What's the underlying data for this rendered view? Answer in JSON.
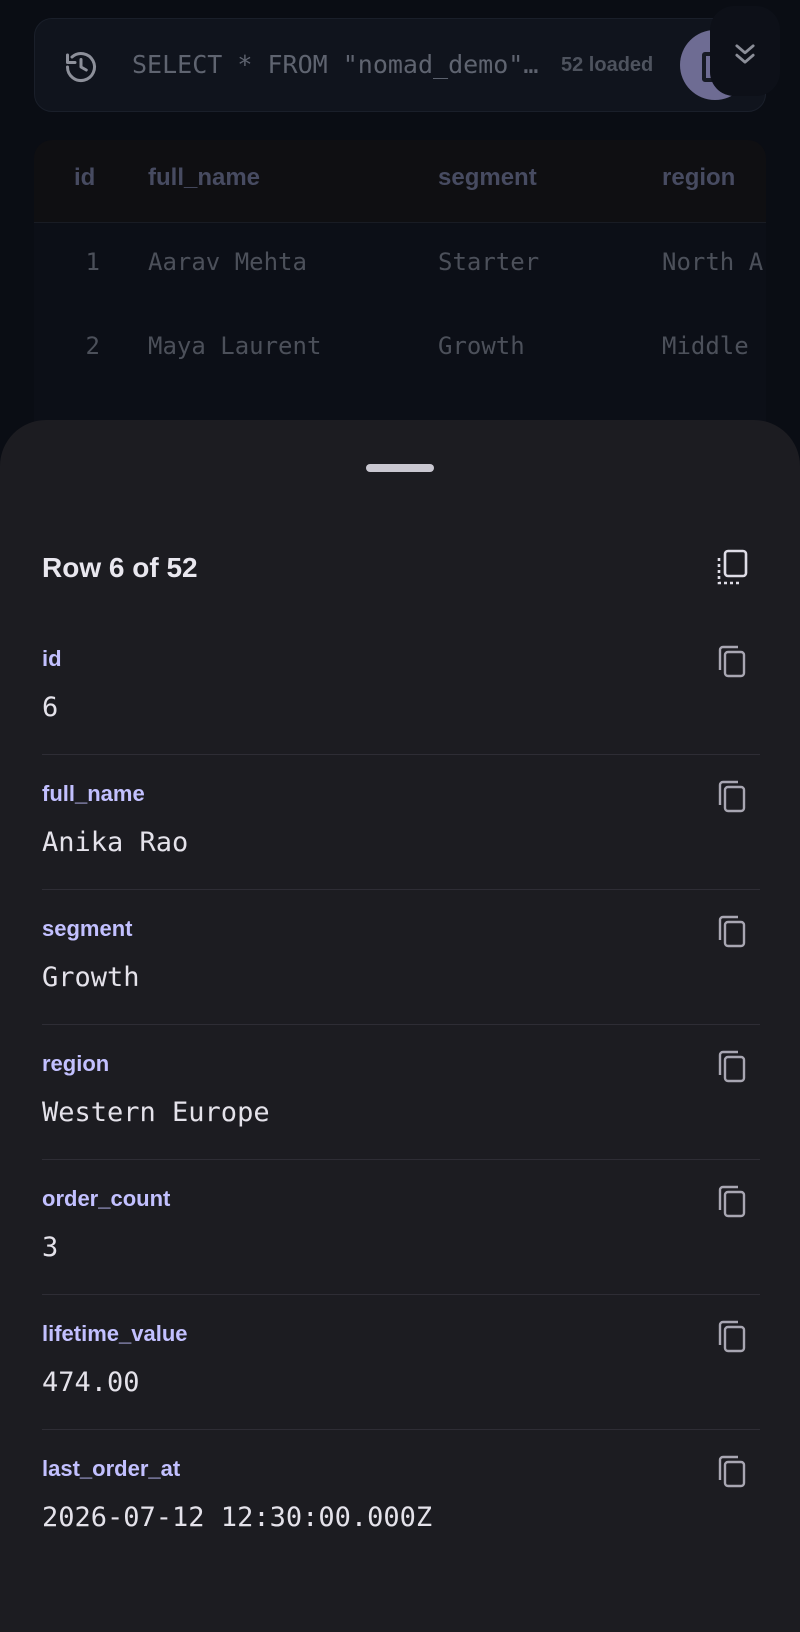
{
  "query_bar": {
    "query_text": "SELECT * FROM \"nomad_demo\"…",
    "loaded_label": "52 loaded"
  },
  "table": {
    "columns": [
      "id",
      "full_name",
      "segment",
      "region"
    ],
    "rows": [
      [
        "1",
        "Aarav Mehta",
        "Starter",
        "North A"
      ],
      [
        "2",
        "Maya Laurent",
        "Growth",
        "Middle"
      ]
    ]
  },
  "sheet": {
    "title": "Row 6 of 52",
    "fields": [
      {
        "label": "id",
        "value": "6"
      },
      {
        "label": "full_name",
        "value": "Anika Rao"
      },
      {
        "label": "segment",
        "value": "Growth"
      },
      {
        "label": "region",
        "value": "Western Europe"
      },
      {
        "label": "order_count",
        "value": "3"
      },
      {
        "label": "lifetime_value",
        "value": "474.00"
      },
      {
        "label": "last_order_at",
        "value": "2026-07-12 12:30:00.000Z"
      }
    ]
  },
  "icons": {
    "history": "history-icon",
    "fab": "results-view-icon",
    "collapse": "double-chevron-down-icon",
    "copy_all": "copy-all-icon",
    "copy": "copy-icon"
  },
  "colors": {
    "accent_label": "#c2c0ff",
    "sheet_background": "#1c1c21",
    "fab": "#6e6c93"
  }
}
